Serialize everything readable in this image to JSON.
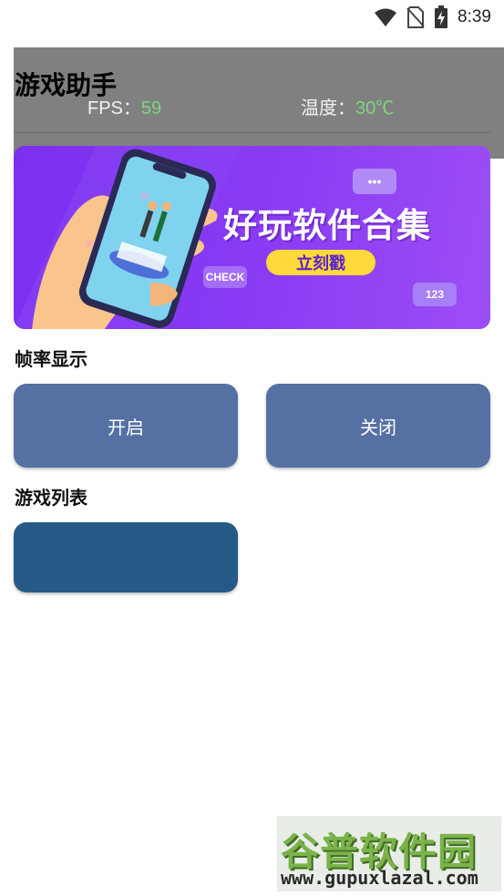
{
  "status_bar": {
    "time": "8:39",
    "icons": [
      "wifi-icon",
      "no-sim-icon",
      "battery-charging-icon"
    ]
  },
  "header": {
    "title": "游戏助手",
    "fps_label": "FPS：",
    "fps_value": "59",
    "temp_label": "温度：",
    "temp_value": "30℃"
  },
  "banner": {
    "headline": "好玩软件合集",
    "button_label": "立刻戳",
    "bubble_check": "CHECK",
    "bubble_123": "123",
    "bubble_dots": "•••"
  },
  "fps_section": {
    "title": "帧率显示",
    "on_label": "开启",
    "off_label": "关闭"
  },
  "games_section": {
    "title": "游戏列表"
  },
  "watermark": {
    "name": "谷普软件园",
    "url": "www.gupuxlazal.com"
  },
  "colors": {
    "button": "#5570a3",
    "game_item": "#265a86",
    "value_green": "#7ed67a",
    "banner_purple": "#8a3cf4",
    "banner_button": "#ffd83a"
  }
}
